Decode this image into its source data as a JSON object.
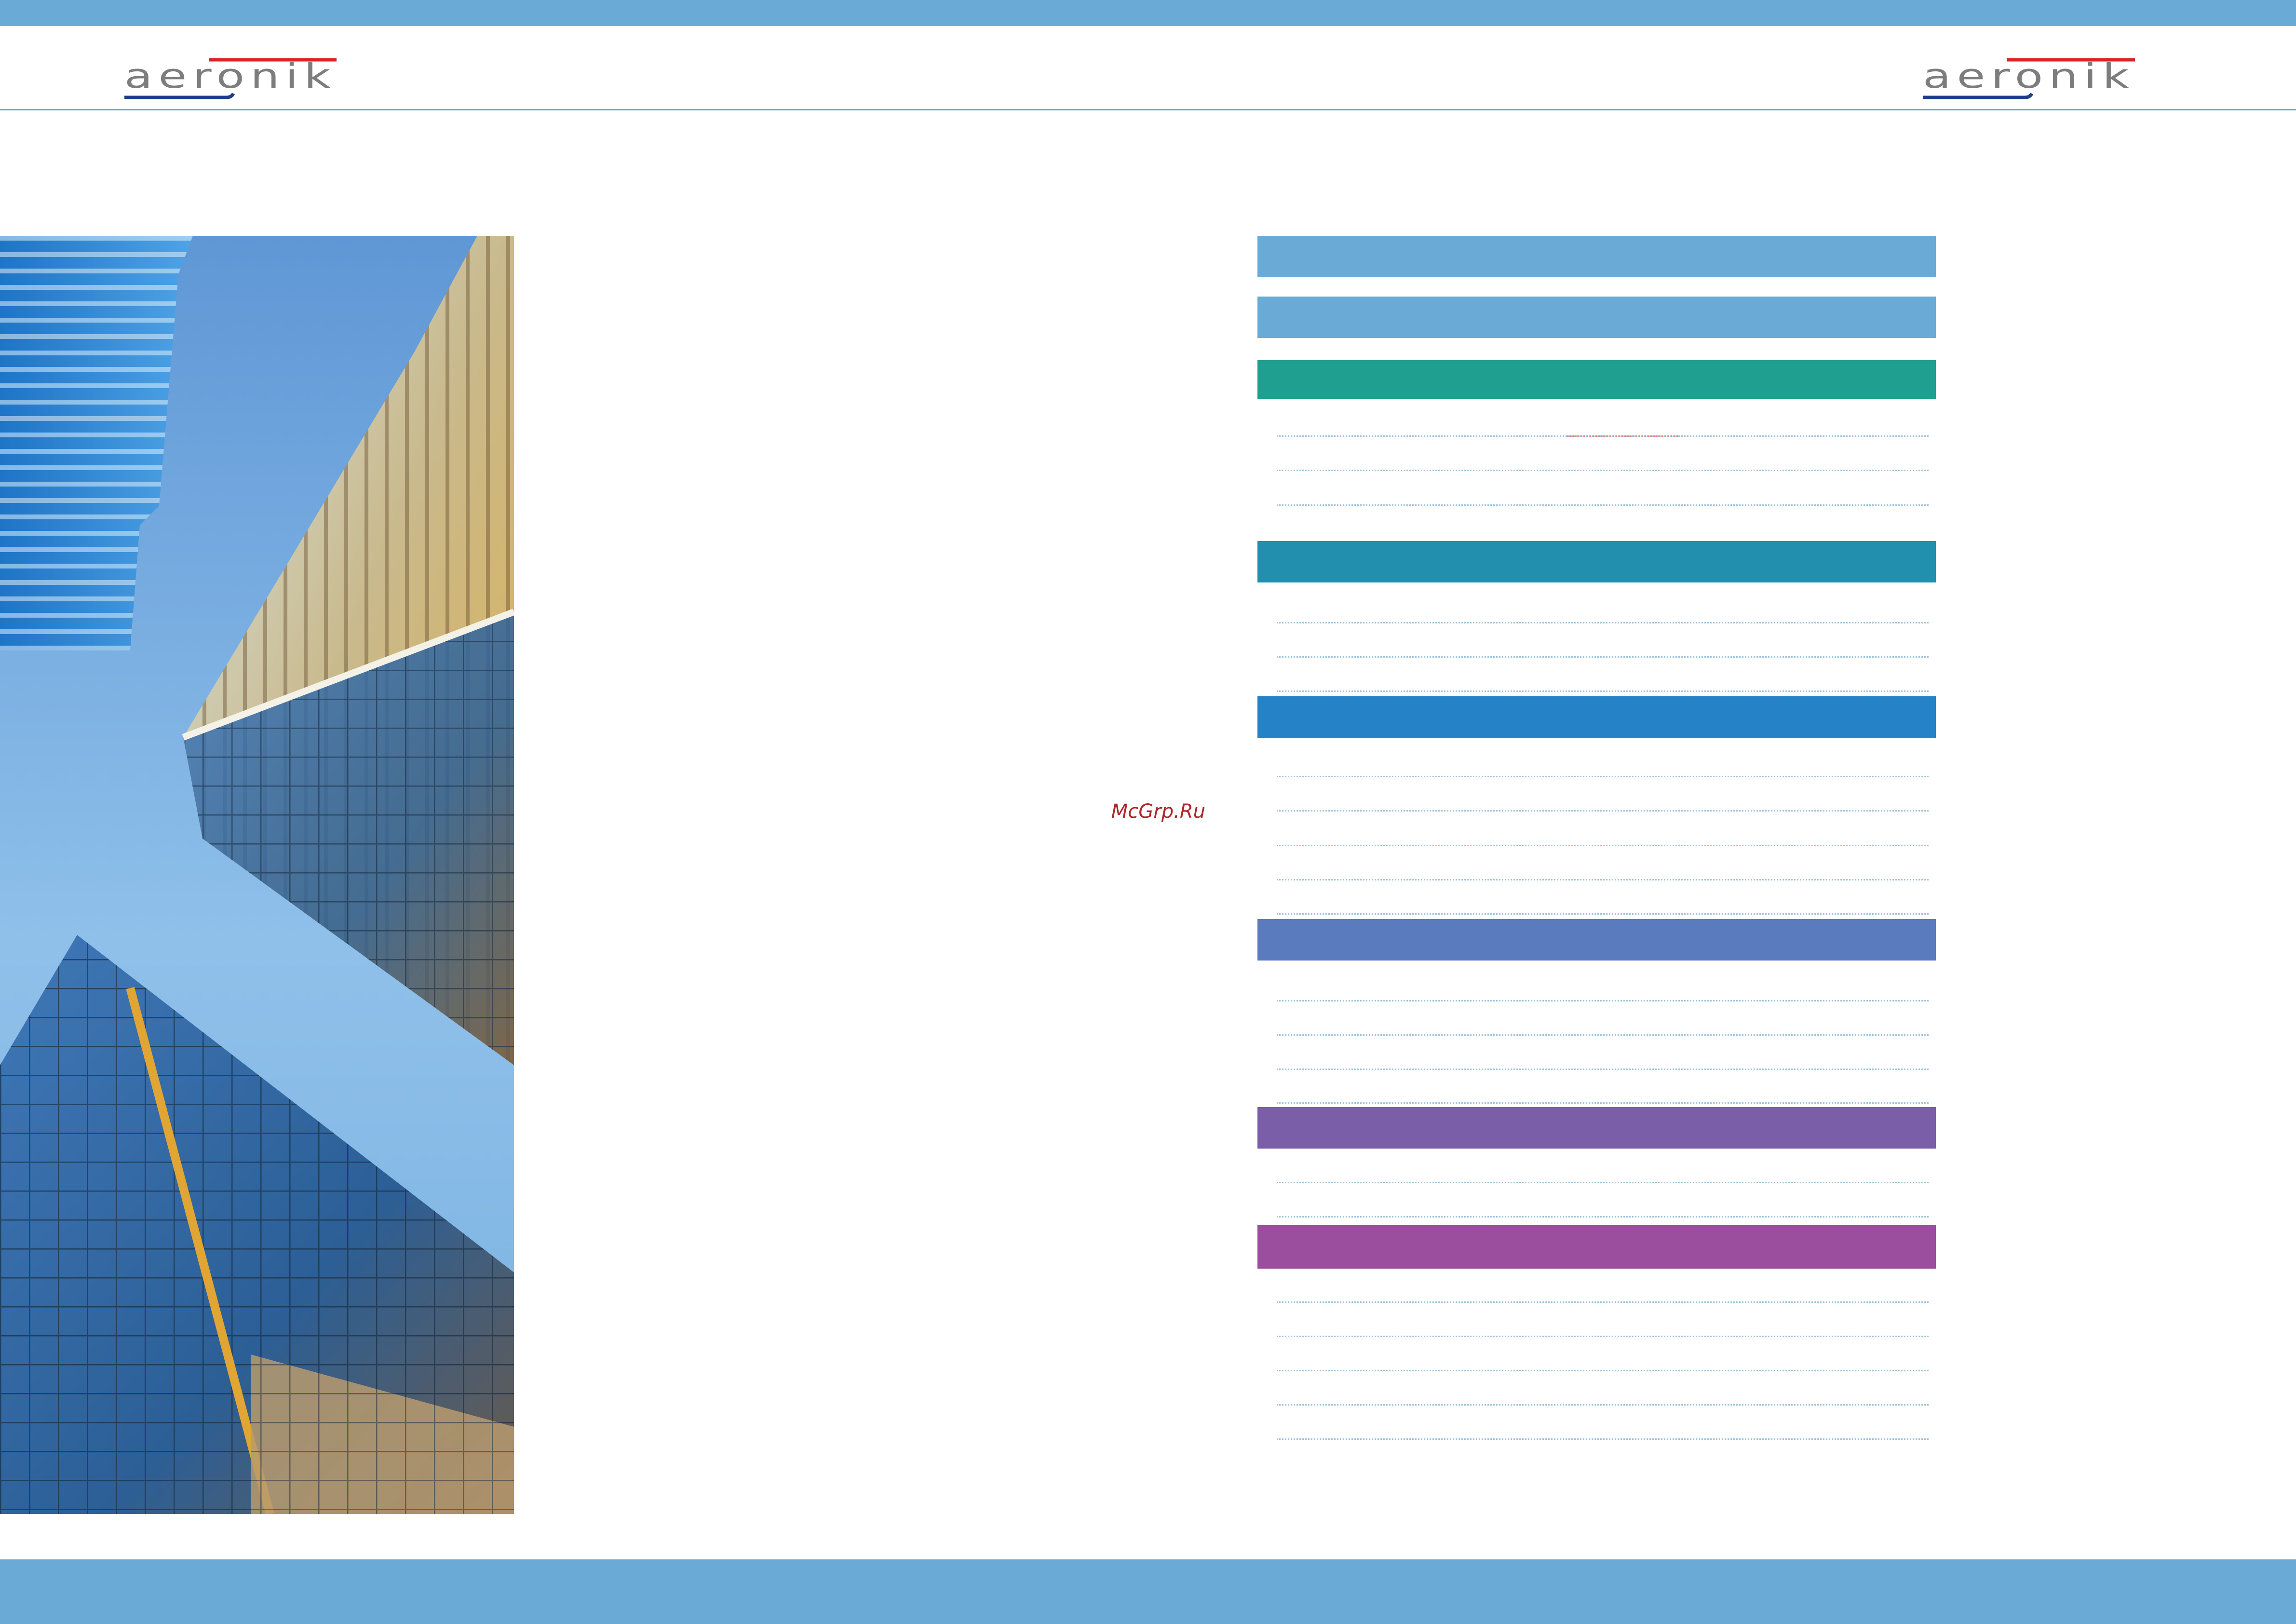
{
  "watermark": {
    "text": "McGrp.Ru"
  },
  "logo": {
    "text": "aeronik"
  },
  "colors": {
    "top_band": "#6aaad6",
    "bottom_band": "#6aaad6",
    "sections": [
      "#6aaad6",
      "#6aaad6",
      "#1f9f90",
      "#238fae",
      "#2582c7",
      "#5b7bbf",
      "#7a5fa8",
      "#9b4d9e"
    ]
  },
  "toc_sections": [
    {
      "color": "#6aaad6",
      "lines": 0
    },
    {
      "color": "#6aaad6",
      "lines": 0
    },
    {
      "color": "#1f9f90",
      "lines": 3
    },
    {
      "color": "#238fae",
      "lines": 3
    },
    {
      "color": "#2582c7",
      "lines": 5
    },
    {
      "color": "#5b7bbf",
      "lines": 4
    },
    {
      "color": "#7a5fa8",
      "lines": 2
    },
    {
      "color": "#9b4d9e",
      "lines": 5
    }
  ]
}
